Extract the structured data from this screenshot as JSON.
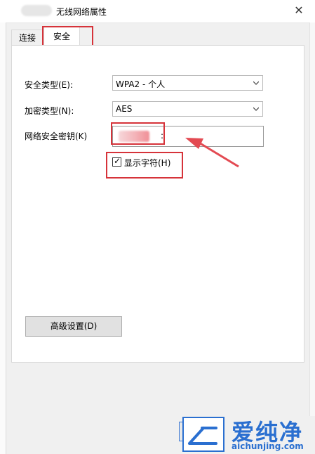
{
  "window": {
    "title": "无线网络属性"
  },
  "tabs": [
    {
      "label": "连接"
    },
    {
      "label": "安全"
    }
  ],
  "security": {
    "type_label": "安全类型(E):",
    "type_value": "WPA2 - 个人",
    "encryption_label": "加密类型(N):",
    "encryption_value": "AES",
    "key_label": "网络安全密钥(K)",
    "key_value_tail": ":",
    "show_chars_label": "显示字符(H)",
    "show_chars_checked": true
  },
  "advanced_button": {
    "label": "高级设置(D)"
  },
  "watermark": {
    "brand": "爱纯净",
    "url": "aichunjing.com"
  },
  "colors": {
    "highlight": "#d6333a",
    "arrow": "#e34a52",
    "brand": "#2a6fd0"
  }
}
